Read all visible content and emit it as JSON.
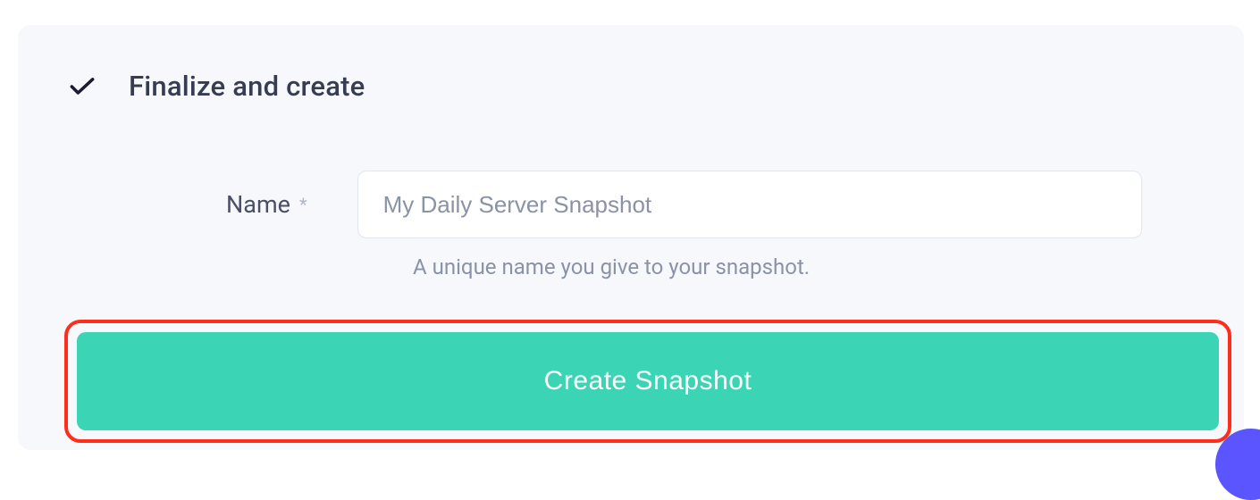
{
  "section": {
    "title": "Finalize and create"
  },
  "form": {
    "name_label": "Name",
    "required_marker": "*",
    "name_placeholder": "My Daily Server Snapshot",
    "name_helper": "A unique name you give to your snapshot."
  },
  "actions": {
    "create_label": "Create Snapshot"
  }
}
